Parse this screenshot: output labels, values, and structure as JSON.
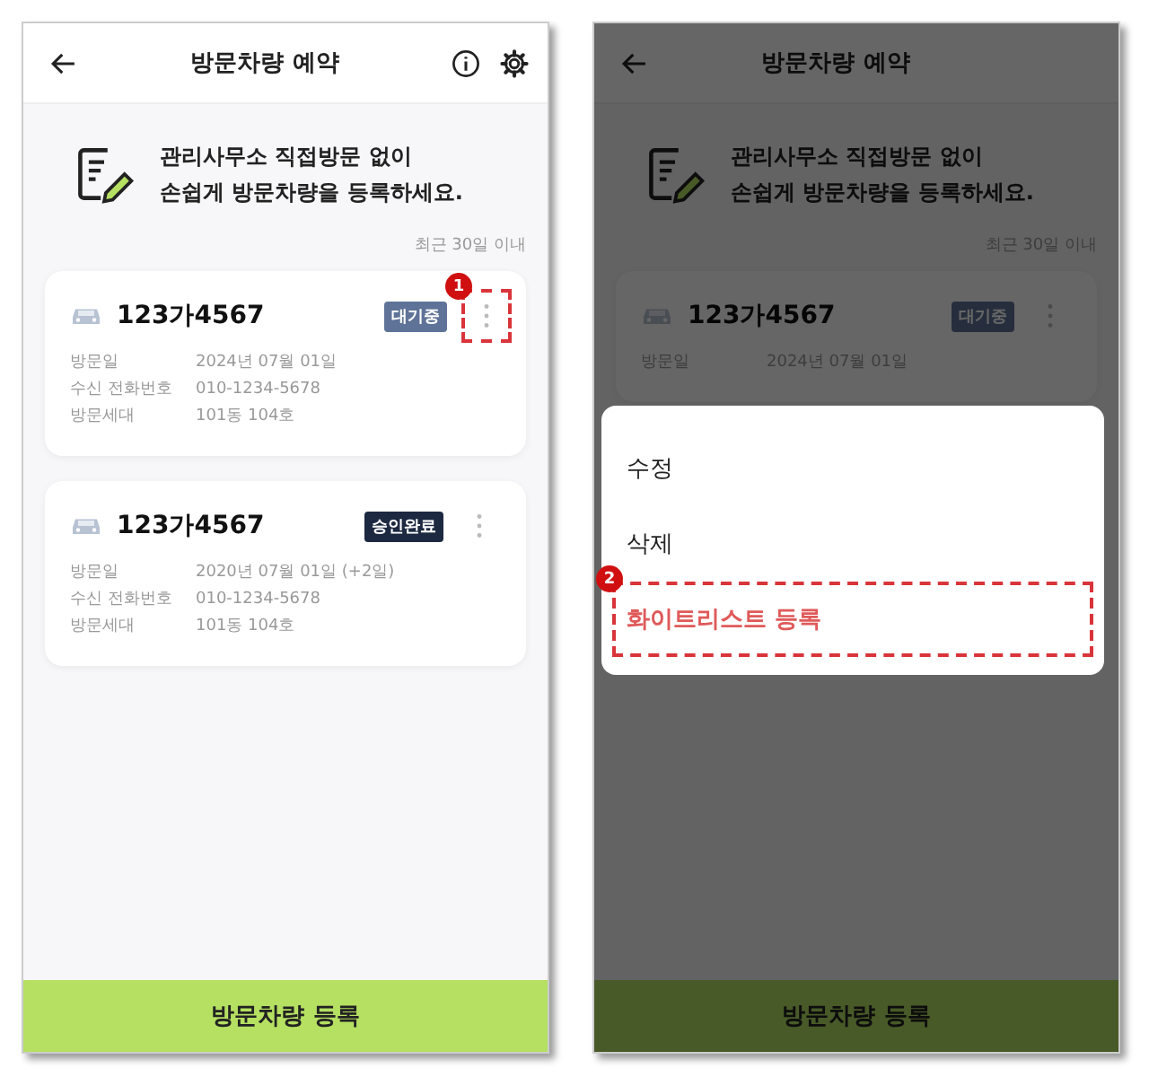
{
  "screens": [
    {
      "title": "방문차량 예약",
      "show_actions": true,
      "banner": [
        "관리사무소 직접방문 없이",
        "손쉽게 방문차량을 등록하세요."
      ],
      "period": "최근 30일 이내",
      "cards": [
        {
          "plate": "123가4567",
          "status": {
            "label": "대기중",
            "kind": "waiting"
          },
          "callout": "1",
          "rows": [
            {
              "label": "방문일",
              "value": "2024년 07월 01일"
            },
            {
              "label": "수신 전화번호",
              "value": "010-1234-5678"
            },
            {
              "label": "방문세대",
              "value": "101동 104호"
            }
          ]
        },
        {
          "plate": "123가4567",
          "status": {
            "label": "승인완료",
            "kind": "approved"
          },
          "rows": [
            {
              "label": "방문일",
              "value": "2020년 07월 01일 (+2일)"
            },
            {
              "label": "수신 전화번호",
              "value": "010-1234-5678"
            },
            {
              "label": "방문세대",
              "value": "101동 104호"
            }
          ]
        }
      ],
      "register_button": "방문차량 등록"
    },
    {
      "title": "방문차량 예약",
      "show_actions": false,
      "banner": [
        "관리사무소 직접방문 없이",
        "손쉽게 방문차량을 등록하세요."
      ],
      "period": "최근 30일 이내",
      "cards": [
        {
          "plate": "123가4567",
          "status": {
            "label": "대기중",
            "kind": "waiting"
          },
          "rows": [
            {
              "label": "방문일",
              "value": "2024년 07월 01일"
            }
          ]
        }
      ],
      "register_button": "방문차량 등록",
      "menu": {
        "items": [
          {
            "label": "수정",
            "selected": false
          },
          {
            "label": "삭제",
            "selected": false
          },
          {
            "label": "화이트리스트 등록",
            "selected": true,
            "callout": "2"
          }
        ]
      }
    }
  ]
}
